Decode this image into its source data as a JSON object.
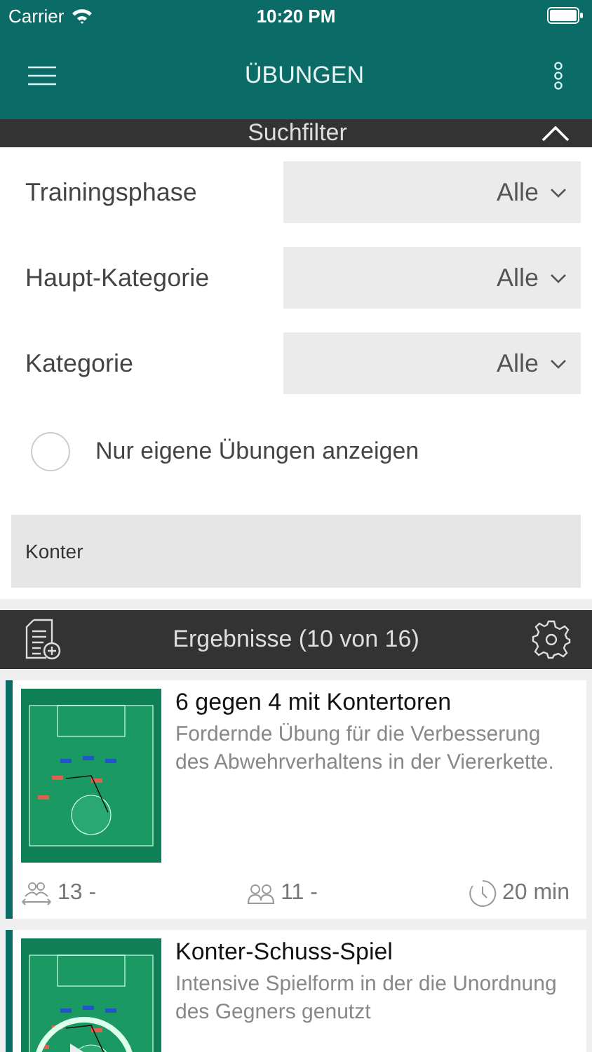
{
  "status_bar": {
    "carrier": "Carrier",
    "time": "10:20 PM"
  },
  "nav_bar": {
    "title": "ÜBUNGEN"
  },
  "filter_header": {
    "title": "Suchfilter",
    "expanded": true
  },
  "filters": [
    {
      "label": "Trainingsphase",
      "value": "Alle"
    },
    {
      "label": "Haupt-Kategorie",
      "value": "Alle"
    },
    {
      "label": "Kategorie",
      "value": "Alle"
    }
  ],
  "own_only": {
    "label": "Nur eigene Übungen anzeigen",
    "checked": false
  },
  "search": {
    "value": "Konter"
  },
  "results_header": {
    "title": "Ergebnisse (10 von 16)"
  },
  "exercises": [
    {
      "title": "6 gegen 4 mit Kontertoren",
      "description": "Fordernde Übung für die Verbesserung des Abwehrverhaltens in der Viererkette.",
      "has_video": false,
      "players": "13 -",
      "groups": "11 -",
      "duration": "20 min"
    },
    {
      "title": "Konter-Schuss-Spiel",
      "description": "Intensive Spielform in der die Unordnung des Gegners genutzt",
      "has_video": true
    }
  ]
}
